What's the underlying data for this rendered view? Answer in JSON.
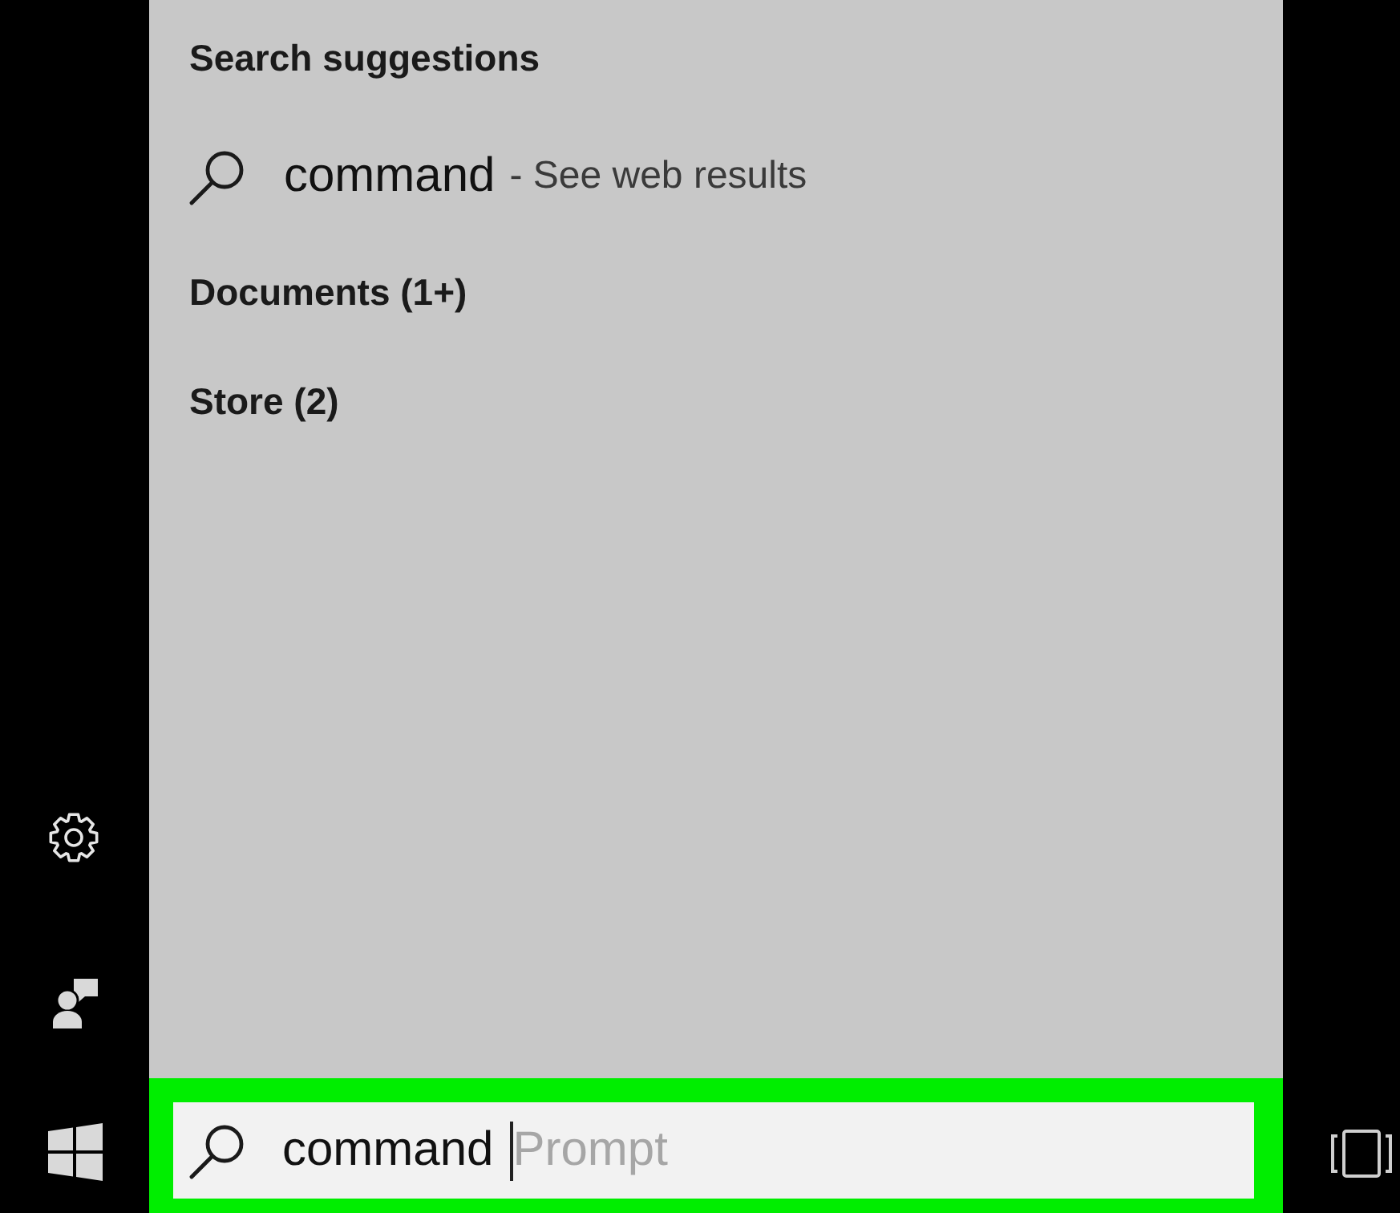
{
  "results": {
    "heading": "Search suggestions",
    "suggestions": [
      {
        "query": "command",
        "hint": "- See web results"
      }
    ],
    "groups": [
      {
        "label": "Documents (1+)"
      },
      {
        "label": "Store (2)"
      }
    ]
  },
  "search_box": {
    "value": "command",
    "completion": "Prompt",
    "highlighted": true
  }
}
